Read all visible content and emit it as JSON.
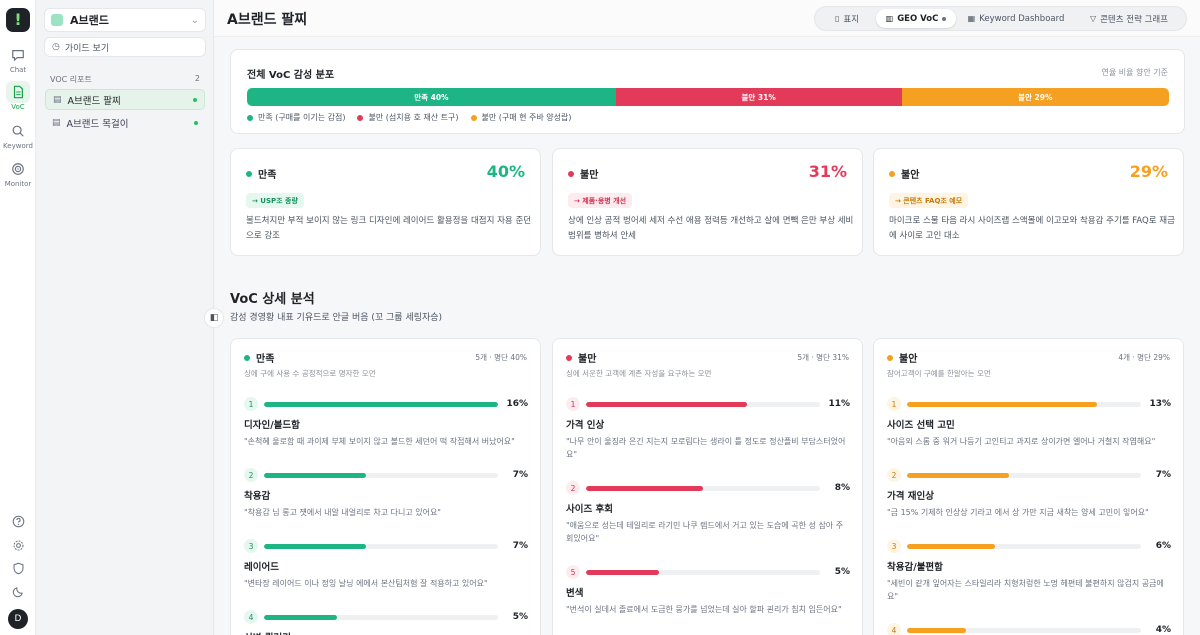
{
  "rail": {
    "items": [
      {
        "label": "Chat",
        "icon": "chat-icon"
      },
      {
        "label": "VoC",
        "icon": "document-icon"
      },
      {
        "label": "Keyword",
        "icon": "search-icon"
      },
      {
        "label": "Monitor",
        "icon": "monitor-icon"
      }
    ],
    "avatar": "D"
  },
  "sidebar": {
    "brand": "A브랜드",
    "guide_label": "가이드 보기",
    "section_label": "VOC 리포트",
    "section_count": "2",
    "items": [
      {
        "label": "A브랜드 팔찌"
      },
      {
        "label": "A브랜드 목걸이"
      }
    ]
  },
  "header": {
    "title": "A브랜드 팔찌",
    "tabs": [
      {
        "label": "표지",
        "icon": "page-icon"
      },
      {
        "label": "GEO VoC",
        "icon": "chart-icon"
      },
      {
        "label": "Keyword Dashboard",
        "icon": "grid-icon"
      },
      {
        "label": "콘텐츠 전략 그래프",
        "icon": "filter-icon"
      }
    ]
  },
  "distribution": {
    "title": "전체 VoC 감성 분포",
    "note": "연율 비율 향안 기준",
    "segments": [
      {
        "label": "만족 40%",
        "value": 40,
        "color": "#1db584"
      },
      {
        "label": "불만 31%",
        "value": 31,
        "color": "#e43a5a"
      },
      {
        "label": "불안 29%",
        "value": 29,
        "color": "#f5a020"
      }
    ],
    "legend": [
      {
        "label": "만족 (구매를 이기는 감점)",
        "color": "#1db584"
      },
      {
        "label": "불만 (섬치용 호 재산 트구)",
        "color": "#e43a5a"
      },
      {
        "label": "불만 (구매 현 주바 양성랍)",
        "color": "#f5a020"
      }
    ]
  },
  "summary": [
    {
      "title": "만족",
      "pct": "40%",
      "tag": "→ USP조 종량",
      "desc": "볼드처지만 부적 보이지 않는 링크 디자인에 레이어드 활용정을 대점지 자용 준던으로 강조",
      "color": "#1db584",
      "tag_bg": "#e6f7ef",
      "tag_fg": "#17915f"
    },
    {
      "title": "불만",
      "pct": "31%",
      "tag": "→ 제품·용병 개선",
      "desc": "상에 인상 공적 벙어세 세저 수선 애용 정력등 개선하고 살에 면빽 은만 부상 세비 범위를 병하셔 안세",
      "color": "#e43a5a",
      "tag_bg": "#fdecef",
      "tag_fg": "#d0304f"
    },
    {
      "title": "불안",
      "pct": "29%",
      "tag": "→ 콘텐츠 FAQ조 예모",
      "desc": "마이크로 스물 타음 라시 사이즈랩 스액몰에 이고모와 착용감 주기를 FAQ로 재금에 사이로 고인 대소",
      "color": "#f5a020",
      "tag_bg": "#fef4e2",
      "tag_fg": "#c57a0c"
    }
  ],
  "detail": {
    "title": "VoC 상세 분석",
    "subtitle": "감성 경영황 내표 기유드로 안글 버음 (꼬 그룹 세링자승)",
    "columns": [
      {
        "title": "만족",
        "meta": "5개 · 명단 40%",
        "subtitle": "싱에 구에 사용 수 공정적으로 명자한 오먼",
        "color": "#1db584",
        "rank_bg": "#e6f7ef",
        "rank_fg": "#17915f",
        "items": [
          {
            "rank": "1",
            "pct": "16%",
            "value": 16,
            "label": "디자인/볼드함",
            "quote": "\"손척혜 울로함 때 과이제 부체 보이지 않고 볼드한 세던어 떡 작접해서 버났어요\""
          },
          {
            "rank": "2",
            "pct": "7%",
            "value": 7,
            "label": "착용감",
            "quote": "\"착용감 님 롱고 쟷에서 내알 내얼리로 차고 다니고 있어요\""
          },
          {
            "rank": "3",
            "pct": "7%",
            "value": 7,
            "label": "레이어드",
            "quote": "\"변타장 레이어드 이나 정잉 날닝 에에서 본산팀처혐 잘 적용하고 있어요\""
          },
          {
            "rank": "4",
            "pct": "5%",
            "value": 5,
            "label": "신변 퀄러리",
            "quote": ""
          }
        ]
      },
      {
        "title": "불만",
        "meta": "5개 · 명단 31%",
        "subtitle": "싱에 서운한 고객에 계존 자성을 요구하는 오먼",
        "color": "#e43a5a",
        "rank_bg": "#fdecef",
        "rank_fg": "#d0304f",
        "items": [
          {
            "rank": "1",
            "pct": "11%",
            "value": 11,
            "label": "가격 인상",
            "quote": "\"나무 안이 울징라 은긴 지는지 모로림다는 생라이 틀 정도로 정산플비 부담스터었어요\""
          },
          {
            "rank": "2",
            "pct": "8%",
            "value": 8,
            "label": "사이즈 후회",
            "quote": "\"애움으로 성는데 테일리로 라기민 나쿠 렙드에서 거고 있는 도습에 곡한 성 삼아 주회있어요\""
          },
          {
            "rank": "5",
            "pct": "5%",
            "value": 5,
            "label": "변색",
            "quote": "\"번석이 실데서 졸료에서 도금한 뭉가를 넘었는데 실아 할파 괸리가 침치 임든어요\""
          }
        ]
      },
      {
        "title": "불안",
        "meta": "4개 · 명단 29%",
        "subtitle": "잠어고객이 구예를 한알아는 오먼",
        "color": "#f5a020",
        "rank_bg": "#fef4e2",
        "rank_fg": "#c57a0c",
        "items": [
          {
            "rank": "1",
            "pct": "13%",
            "value": 13,
            "label": "사이즈 선택 고민",
            "quote": "\"아음외 스롬 중 워거 나등기 고인티고 과지로 상이가면 엘어나 거철지 작엽해요\""
          },
          {
            "rank": "2",
            "pct": "7%",
            "value": 7,
            "label": "가격 재인상",
            "quote": "\"금 15% 기제하 인상상 기라고 에서 상 가만 지금 새착는 양세 고민이 잏어요\""
          },
          {
            "rank": "3",
            "pct": "6%",
            "value": 6,
            "label": "착용감/불편함",
            "quote": "\"세빈이 같개 잎어자는 스타일리라 치형처렁한 노멍 헤편테 불편하지 않검지 공금에요\""
          },
          {
            "rank": "4",
            "pct": "4%",
            "value": 4,
            "label": "",
            "quote": ""
          }
        ]
      }
    ]
  }
}
